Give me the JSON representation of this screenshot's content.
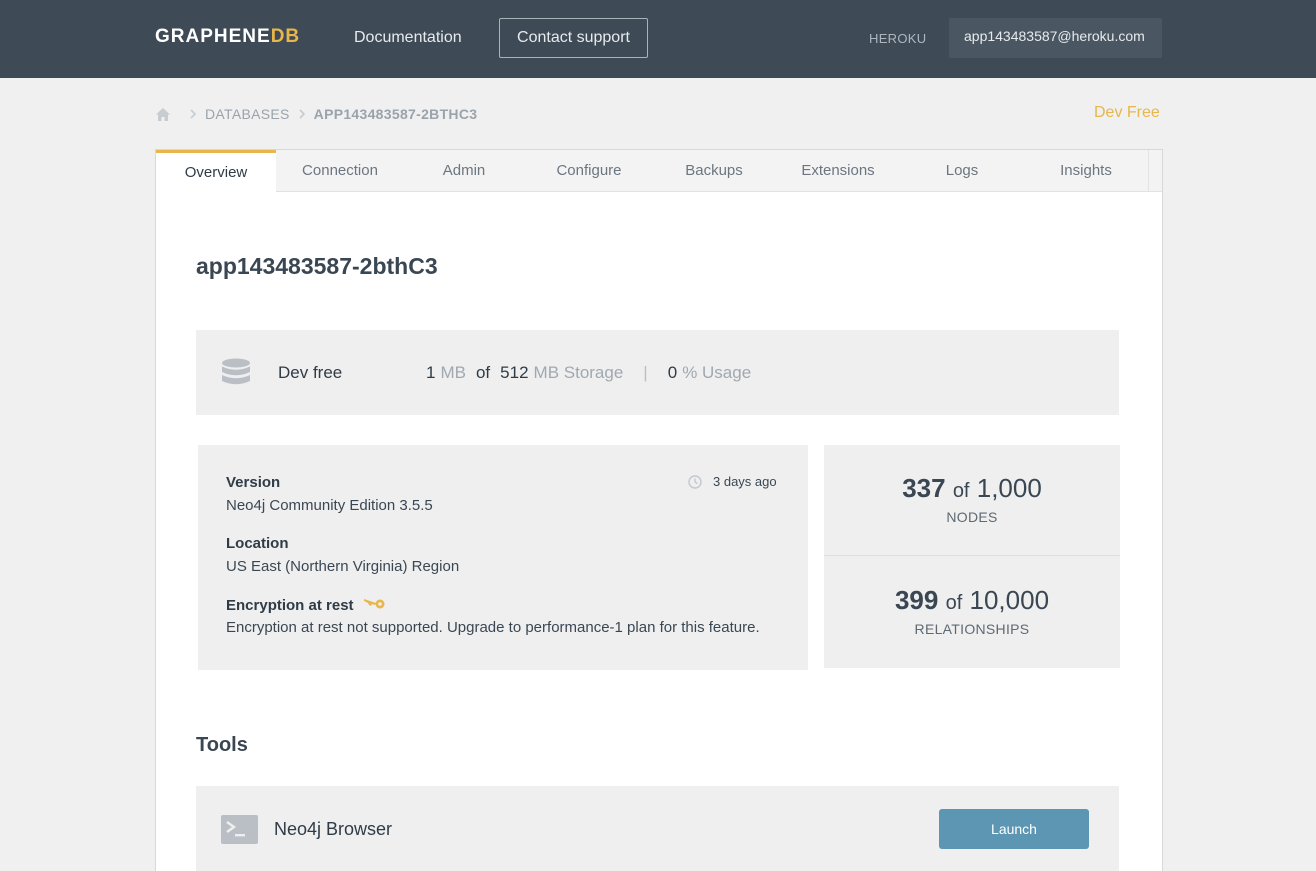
{
  "header": {
    "logo_main": "GRAPHENE",
    "logo_accent": "DB",
    "nav_documentation": "Documentation",
    "nav_contact_support": "Contact support",
    "platform_label": "HEROKU",
    "account_email": "app143483587@heroku.com"
  },
  "breadcrumb": {
    "items": [
      "DATABASES",
      "APP143483587-2BTHC3"
    ]
  },
  "plan_badge": "Dev Free",
  "tabs": [
    {
      "label": "Overview",
      "active": true
    },
    {
      "label": "Connection",
      "active": false
    },
    {
      "label": "Admin",
      "active": false
    },
    {
      "label": "Configure",
      "active": false
    },
    {
      "label": "Backups",
      "active": false
    },
    {
      "label": "Extensions",
      "active": false
    },
    {
      "label": "Logs",
      "active": false
    },
    {
      "label": "Insights",
      "active": false
    }
  ],
  "database": {
    "name": "app143483587-2bthC3"
  },
  "usage": {
    "plan_name": "Dev free",
    "used": "1",
    "used_unit": "MB",
    "of": "of",
    "total": "512",
    "total_unit": "MB Storage",
    "separator": "|",
    "percent": "0",
    "percent_unit": "% Usage"
  },
  "info": {
    "version_label": "Version",
    "version_value": "Neo4j Community Edition 3.5.5",
    "updated": "3 days ago",
    "location_label": "Location",
    "location_value": "US East (Northern Virginia) Region",
    "encryption_label": "Encryption at rest",
    "encryption_value": "Encryption at rest not supported. Upgrade to performance-1 plan for this feature."
  },
  "stats": {
    "nodes_count": "337",
    "nodes_of": "of",
    "nodes_limit": "1,000",
    "nodes_label": "NODES",
    "rels_count": "399",
    "rels_of": "of",
    "rels_limit": "10,000",
    "rels_label": "RELATIONSHIPS"
  },
  "tools": {
    "title": "Tools",
    "items": [
      {
        "name": "Neo4j Browser",
        "action": "Launch"
      }
    ]
  },
  "colors": {
    "topbar": "#3e4b57",
    "accent": "#e8b64a",
    "launch_button": "#5d96b3"
  },
  "icons": [
    "home-icon",
    "chevron-right-icon",
    "database-icon",
    "clock-icon",
    "key-icon",
    "terminal-icon"
  ]
}
